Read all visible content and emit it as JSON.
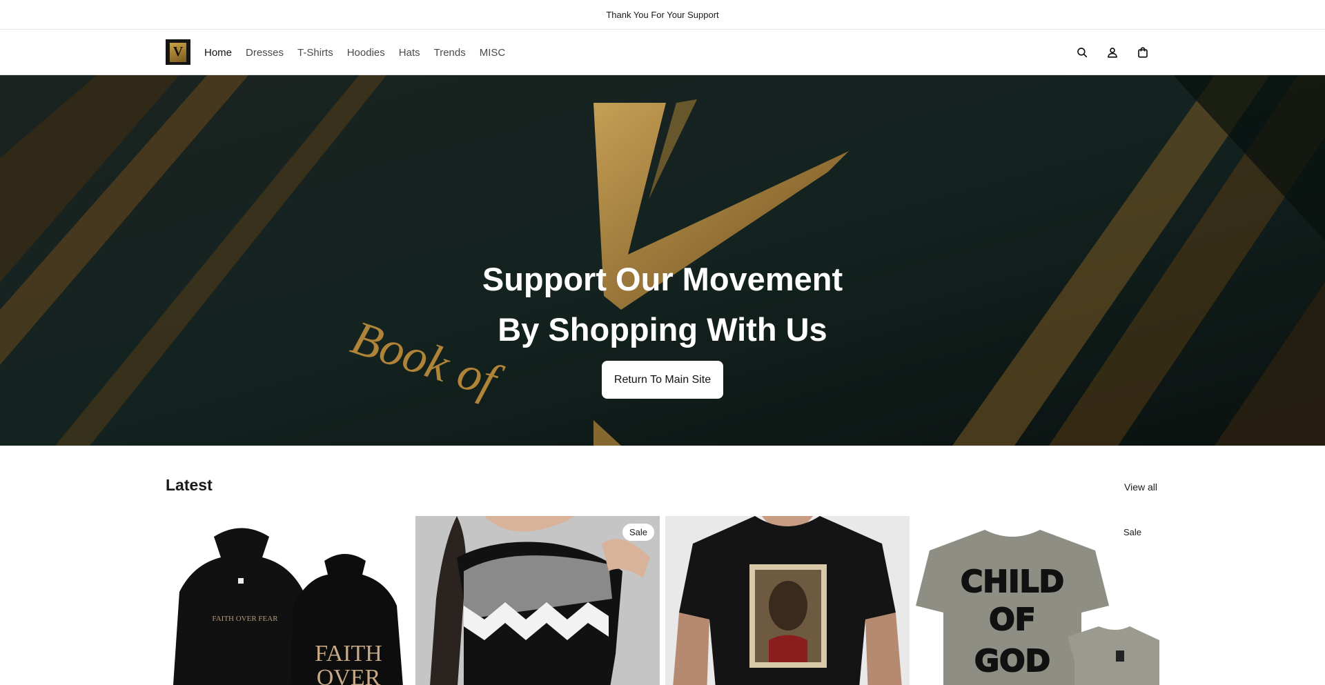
{
  "announcement": {
    "text": "Thank You For Your Support"
  },
  "header": {
    "logo_letter": "V",
    "nav": [
      {
        "label": "Home"
      },
      {
        "label": "Dresses"
      },
      {
        "label": "T-Shirts"
      },
      {
        "label": "Hoodies"
      },
      {
        "label": "Hats"
      },
      {
        "label": "Trends"
      },
      {
        "label": "MISC"
      }
    ],
    "icons": [
      "search-icon",
      "account-icon",
      "cart-icon"
    ]
  },
  "hero": {
    "title_line1": "Support Our Movement",
    "title_line2": "By Shopping With Us",
    "button_label": "Return To Main Site",
    "bg_text_book": "Book of",
    "bg_letter": "V"
  },
  "latest": {
    "title": "Latest",
    "view_all_label": "View all",
    "products": [
      {
        "image_alt": "Faith Over Fear hoodies",
        "print_small": "FAITH OVER FEAR",
        "print_large_1": "FAITH",
        "print_large_2": "OVER",
        "badge": ""
      },
      {
        "image_alt": "Zigzag knit dress",
        "badge": "Sale"
      },
      {
        "image_alt": "Jesus graphic t-shirt",
        "badge": ""
      },
      {
        "image_alt": "Child of God t-shirt",
        "print_1": "CHILD",
        "print_2": "OF",
        "print_3": "GOD",
        "badge": "Sale"
      }
    ]
  },
  "colors": {
    "hero_gold": "#b8893a",
    "hero_dark": "#0f1a17",
    "text": "#1a1a1a"
  }
}
